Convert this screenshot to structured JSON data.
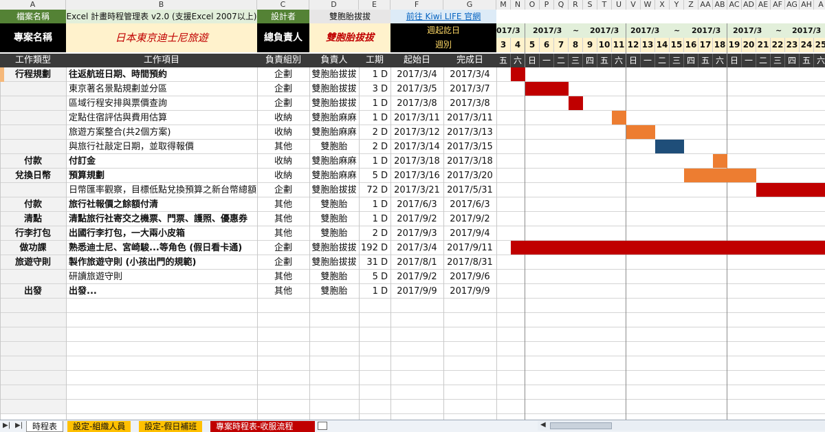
{
  "col_letters": [
    "A",
    "B",
    "C",
    "D",
    "E",
    "F",
    "G"
  ],
  "right_col_letters": [
    "M",
    "N",
    "O",
    "P",
    "Q",
    "R",
    "S",
    "T",
    "U",
    "V",
    "W",
    "X",
    "Y",
    "Z",
    "AA",
    "AB",
    "AC",
    "AD",
    "AE",
    "AF",
    "AG",
    "AH",
    "A"
  ],
  "meta": {
    "file_label": "檔案名稱",
    "file_name": "Excel 計畫時程管理表 v2.0 (支援Excel 2007以上)",
    "designer_label": "設計者",
    "designer": "雙胞胎拔拔",
    "link": "前往 Kiwi LIFE 官網",
    "project_label": "專案名稱",
    "project_name": "日本東京迪士尼旅遊",
    "owner_label": "總負責人",
    "owner": "雙胞胎拔拔",
    "week_start_label": "週起訖日",
    "week_label": "週別"
  },
  "headers": [
    "工作類型",
    "工作項目",
    "負責組別",
    "負責人",
    "工期",
    "起始日",
    "完成日"
  ],
  "timeline": {
    "week_labels": [
      "017/3",
      "2017/3",
      "~",
      "2017/3",
      "2017/3",
      "~",
      "2017/3",
      "2017/3",
      "~",
      "2017/3"
    ],
    "days": [
      "3",
      "4",
      "5",
      "6",
      "7",
      "8",
      "9",
      "10",
      "11",
      "12",
      "13",
      "14",
      "15",
      "16",
      "17",
      "18",
      "19",
      "20",
      "21",
      "22",
      "23",
      "24",
      "25"
    ],
    "weekdays": [
      "五",
      "六",
      "日",
      "一",
      "二",
      "三",
      "四",
      "五",
      "六",
      "日",
      "一",
      "二",
      "三",
      "四",
      "五",
      "六",
      "日",
      "一",
      "二",
      "三",
      "四",
      "五",
      "六"
    ]
  },
  "rows": [
    {
      "type": "行程規劃",
      "item": "往返航班日期、時間預約",
      "group": "企劃",
      "owner": "雙胞胎拔拔",
      "dur": "1 D",
      "start": "2017/3/4",
      "end": "2017/3/4",
      "bold": true
    },
    {
      "type": "",
      "item": "東京著名景點規劃並分區",
      "group": "企劃",
      "owner": "雙胞胎拔拔",
      "dur": "3 D",
      "start": "2017/3/5",
      "end": "2017/3/7",
      "bold": false
    },
    {
      "type": "",
      "item": "區域行程安排與票價查詢",
      "group": "企劃",
      "owner": "雙胞胎拔拔",
      "dur": "1 D",
      "start": "2017/3/8",
      "end": "2017/3/8",
      "bold": false
    },
    {
      "type": "",
      "item": "定點住宿評估與費用估算",
      "group": "收納",
      "owner": "雙胞胎麻麻",
      "dur": "1 D",
      "start": "2017/3/11",
      "end": "2017/3/11",
      "bold": false
    },
    {
      "type": "",
      "item": "旅遊方案整合(共2個方案)",
      "group": "收納",
      "owner": "雙胞胎麻麻",
      "dur": "2 D",
      "start": "2017/3/12",
      "end": "2017/3/13",
      "bold": false
    },
    {
      "type": "",
      "item": "與旅行社敲定日期，並取得報價",
      "group": "其他",
      "owner": "雙胞胎",
      "dur": "2 D",
      "start": "2017/3/14",
      "end": "2017/3/15",
      "bold": false
    },
    {
      "type": "付款",
      "item": "付訂金",
      "group": "收納",
      "owner": "雙胞胎麻麻",
      "dur": "1 D",
      "start": "2017/3/18",
      "end": "2017/3/18",
      "bold": true
    },
    {
      "type": "兌換日幣",
      "item": "預算規劃",
      "group": "收納",
      "owner": "雙胞胎麻麻",
      "dur": "5 D",
      "start": "2017/3/16",
      "end": "2017/3/20",
      "bold": true
    },
    {
      "type": "",
      "item": "日幣匯率觀察，目標低點兌換預算之新台幣總額",
      "group": "企劃",
      "owner": "雙胞胎拔拔",
      "dur": "72 D",
      "start": "2017/3/21",
      "end": "2017/5/31",
      "bold": false
    },
    {
      "type": "付款",
      "item": "旅行社報價之餘額付清",
      "group": "其他",
      "owner": "雙胞胎",
      "dur": "1 D",
      "start": "2017/6/3",
      "end": "2017/6/3",
      "bold": true
    },
    {
      "type": "清點",
      "item": "清點旅行社寄交之機票、門票、護照、優惠券",
      "group": "其他",
      "owner": "雙胞胎",
      "dur": "1 D",
      "start": "2017/9/2",
      "end": "2017/9/2",
      "bold": true
    },
    {
      "type": "行李打包",
      "item": "出國行李打包，一大兩小皮箱",
      "group": "其他",
      "owner": "雙胞胎",
      "dur": "2 D",
      "start": "2017/9/3",
      "end": "2017/9/4",
      "bold": true
    },
    {
      "type": "做功課",
      "item": "熟悉迪士尼、宮崎駿...等角色 (假日看卡通)",
      "group": "企劃",
      "owner": "雙胞胎拔拔",
      "dur": "192 D",
      "start": "2017/3/4",
      "end": "2017/9/11",
      "bold": true
    },
    {
      "type": "旅遊守則",
      "item": "製作旅遊守則 (小孩出門的規範)",
      "group": "企劃",
      "owner": "雙胞胎拔拔",
      "dur": "31 D",
      "start": "2017/8/1",
      "end": "2017/8/31",
      "bold": true
    },
    {
      "type": "",
      "item": "研讀旅遊守則",
      "group": "其他",
      "owner": "雙胞胎",
      "dur": "5 D",
      "start": "2017/9/2",
      "end": "2017/9/6",
      "bold": false
    },
    {
      "type": "出發",
      "item": "出發...",
      "group": "其他",
      "owner": "雙胞胎",
      "dur": "1 D",
      "start": "2017/9/9",
      "end": "2017/9/9",
      "bold": true
    }
  ],
  "colors": {
    "red": "#c00000",
    "orange": "#ed7d31",
    "blue": "#1f4e79",
    "green_hdr": "#4f7a28",
    "cream": "#fff2cc",
    "dark_hdr": "#404040",
    "black": "#000000"
  },
  "sheet_tabs": [
    "時程表",
    "設定-組織人員",
    "設定-假日補班",
    "專案時程表-收服流程"
  ]
}
